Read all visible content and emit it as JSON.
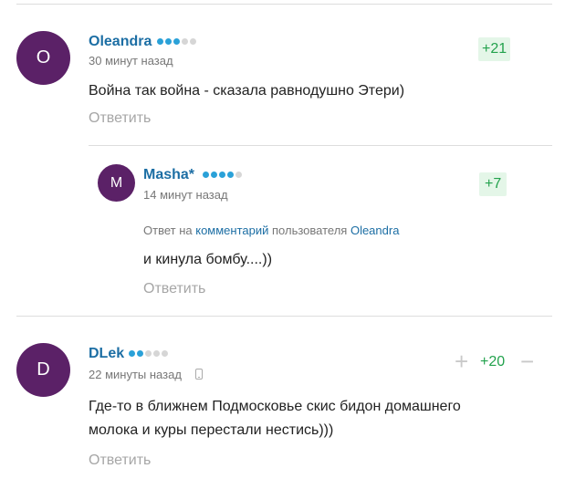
{
  "comments": [
    {
      "avatar_letter": "O",
      "author": "Oleandra",
      "rating_dots": 3,
      "time": "30 минут назад",
      "score": "+21",
      "text": "Война так война - сказала равнодушно Этери)",
      "reply_label": "Ответить"
    },
    {
      "avatar_letter": "M",
      "author": "Masha*",
      "rating_dots": 4,
      "time": "14 минут назад",
      "score": "+7",
      "reply_to_prefix": "Ответ на",
      "reply_to_link": "комментарий",
      "reply_to_middle": "пользователя",
      "reply_to_user": "Oleandra",
      "text": "и кинула бомбу....))",
      "reply_label": "Ответить"
    },
    {
      "avatar_letter": "D",
      "author": "DLek",
      "rating_dots": 2,
      "time": "22 минуты назад",
      "score": "+20",
      "text_line1": "Где-то в ближнем Подмосковье скис бидон домашнего",
      "text_line2": "молока и куры перестали нестись)))",
      "reply_label": "Ответить",
      "vote_up": "+",
      "vote_down": "−"
    }
  ]
}
